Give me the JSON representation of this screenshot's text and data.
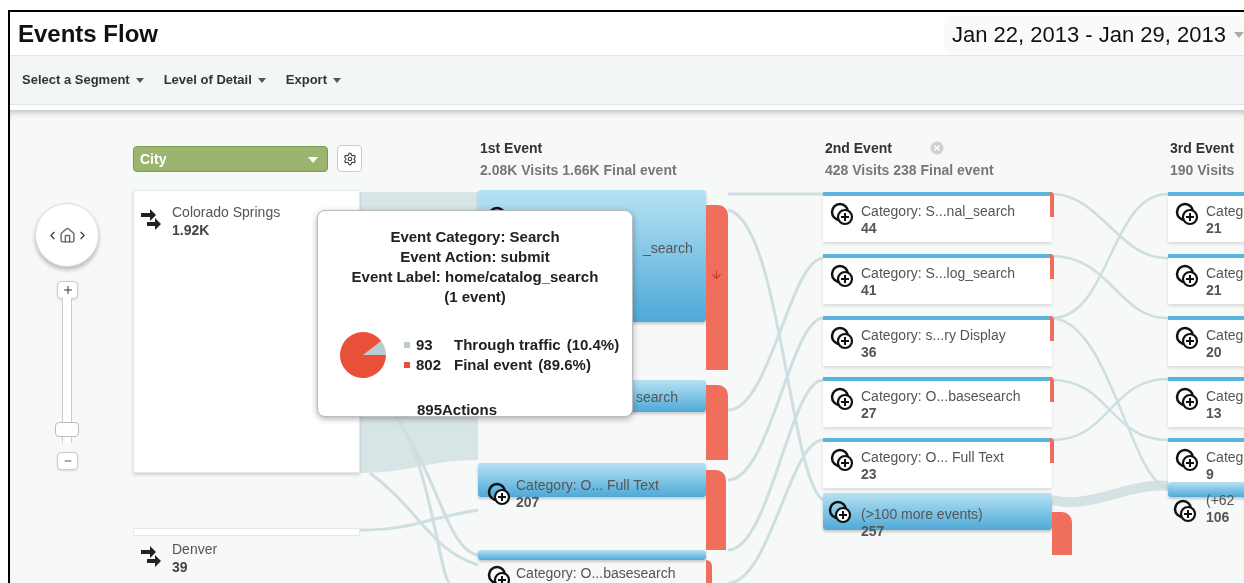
{
  "title": "Events Flow",
  "date_range": "Jan 22, 2013 - Jan 29, 2013",
  "toolbar": [
    "Select a Segment",
    "Level of Detail",
    "Export"
  ],
  "dimension": {
    "label": "City"
  },
  "zoom": {
    "level": 0.05
  },
  "sources": [
    {
      "name": "Colorado Springs",
      "count": "1.92K"
    },
    {
      "name": "Denver",
      "count": "39"
    }
  ],
  "columns": [
    {
      "title": "1st Event",
      "stats": "2.08K Visits 1.66K Final event",
      "closable": false,
      "nodes": [
        {
          "label": "_search",
          "highlighted": true
        },
        {
          "label": "search",
          "highlighted": true
        },
        {
          "label": "Category: O... Full Text",
          "count": "207",
          "highlighted": true
        },
        {
          "label": "Category: O...basesearch",
          "highlighted": true
        }
      ]
    },
    {
      "title": "2nd Event",
      "stats": "428 Visits 238 Final event",
      "closable": true,
      "nodes": [
        {
          "label": "Category: S...nal_search",
          "count": "44",
          "highlighted": false
        },
        {
          "label": "Category: S...log_search",
          "count": "41",
          "highlighted": false
        },
        {
          "label": "Category: s...ry Display",
          "count": "36",
          "highlighted": false
        },
        {
          "label": "Category: O...basesearch",
          "count": "27",
          "highlighted": false
        },
        {
          "label": "Category: O... Full Text",
          "count": "23",
          "highlighted": false
        },
        {
          "label": "(>100 more events)",
          "count": "257",
          "highlighted": true
        }
      ]
    },
    {
      "title": "3rd Event",
      "stats": "190 Visits",
      "closable": false,
      "nodes": [
        {
          "label": "Categ",
          "count": "21",
          "highlighted": false
        },
        {
          "label": "Categ",
          "count": "21",
          "highlighted": false
        },
        {
          "label": "Categ",
          "count": "20",
          "highlighted": false
        },
        {
          "label": "Categ",
          "count": "13",
          "highlighted": false
        },
        {
          "label": "Categ",
          "count": "9",
          "highlighted": false
        },
        {
          "label": "(+62",
          "count": "106",
          "highlighted": true
        }
      ]
    }
  ],
  "tooltip": {
    "lines": [
      "Event Category: Search",
      "Event Action: submit",
      "Event Label: home/catalog_search",
      "(1 event)"
    ],
    "chart_data": {
      "type": "pie",
      "categories": [
        "Through traffic",
        "Final event"
      ],
      "values": [
        10.4,
        89.6
      ]
    },
    "legend": [
      {
        "value": "93",
        "percent": "(10.4%)",
        "color": "#b9cdd0"
      },
      {
        "value": "802",
        "percent": "(89.6%)",
        "color": "#e8503a"
      }
    ],
    "total": "895Actions"
  }
}
